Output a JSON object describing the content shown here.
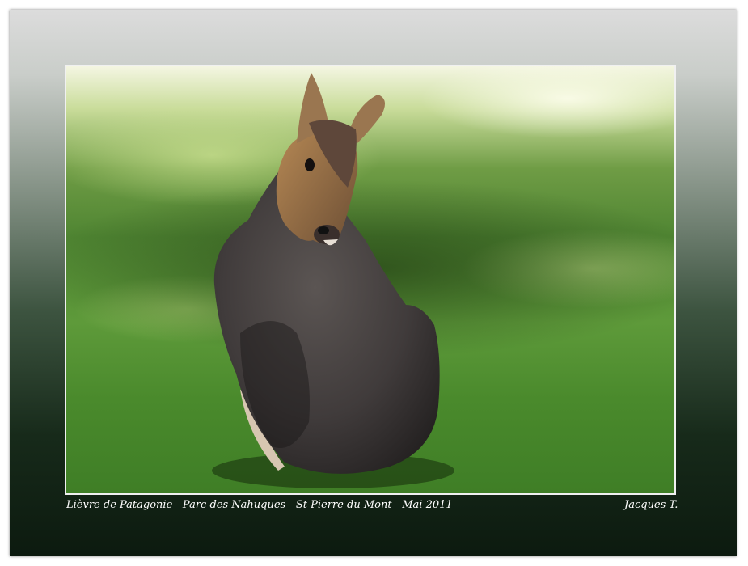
{
  "photo": {
    "subject": "animal-photo"
  },
  "caption": {
    "left": "Lièvre de Patagonie - Parc des Nahuques - St Pierre du Mont - Mai 2011",
    "right": "Jacques T."
  },
  "colors": {
    "frame_top": "#dcdcdc",
    "frame_bottom": "#0c1a0f",
    "grass": "#4f8532",
    "animal_body": "#4a4545",
    "animal_face": "#a47a4c"
  }
}
